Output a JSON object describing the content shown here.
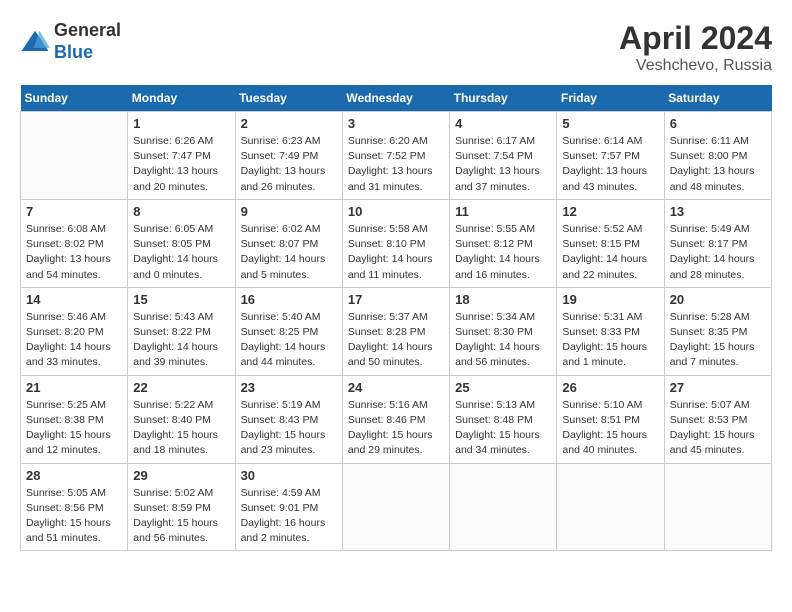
{
  "logo": {
    "general": "General",
    "blue": "Blue"
  },
  "title": "April 2024",
  "location": "Veshchevo, Russia",
  "days_header": [
    "Sunday",
    "Monday",
    "Tuesday",
    "Wednesday",
    "Thursday",
    "Friday",
    "Saturday"
  ],
  "weeks": [
    [
      {
        "day": "",
        "info": ""
      },
      {
        "day": "1",
        "info": "Sunrise: 6:26 AM\nSunset: 7:47 PM\nDaylight: 13 hours\nand 20 minutes."
      },
      {
        "day": "2",
        "info": "Sunrise: 6:23 AM\nSunset: 7:49 PM\nDaylight: 13 hours\nand 26 minutes."
      },
      {
        "day": "3",
        "info": "Sunrise: 6:20 AM\nSunset: 7:52 PM\nDaylight: 13 hours\nand 31 minutes."
      },
      {
        "day": "4",
        "info": "Sunrise: 6:17 AM\nSunset: 7:54 PM\nDaylight: 13 hours\nand 37 minutes."
      },
      {
        "day": "5",
        "info": "Sunrise: 6:14 AM\nSunset: 7:57 PM\nDaylight: 13 hours\nand 43 minutes."
      },
      {
        "day": "6",
        "info": "Sunrise: 6:11 AM\nSunset: 8:00 PM\nDaylight: 13 hours\nand 48 minutes."
      }
    ],
    [
      {
        "day": "7",
        "info": "Sunrise: 6:08 AM\nSunset: 8:02 PM\nDaylight: 13 hours\nand 54 minutes."
      },
      {
        "day": "8",
        "info": "Sunrise: 6:05 AM\nSunset: 8:05 PM\nDaylight: 14 hours\nand 0 minutes."
      },
      {
        "day": "9",
        "info": "Sunrise: 6:02 AM\nSunset: 8:07 PM\nDaylight: 14 hours\nand 5 minutes."
      },
      {
        "day": "10",
        "info": "Sunrise: 5:58 AM\nSunset: 8:10 PM\nDaylight: 14 hours\nand 11 minutes."
      },
      {
        "day": "11",
        "info": "Sunrise: 5:55 AM\nSunset: 8:12 PM\nDaylight: 14 hours\nand 16 minutes."
      },
      {
        "day": "12",
        "info": "Sunrise: 5:52 AM\nSunset: 8:15 PM\nDaylight: 14 hours\nand 22 minutes."
      },
      {
        "day": "13",
        "info": "Sunrise: 5:49 AM\nSunset: 8:17 PM\nDaylight: 14 hours\nand 28 minutes."
      }
    ],
    [
      {
        "day": "14",
        "info": "Sunrise: 5:46 AM\nSunset: 8:20 PM\nDaylight: 14 hours\nand 33 minutes."
      },
      {
        "day": "15",
        "info": "Sunrise: 5:43 AM\nSunset: 8:22 PM\nDaylight: 14 hours\nand 39 minutes."
      },
      {
        "day": "16",
        "info": "Sunrise: 5:40 AM\nSunset: 8:25 PM\nDaylight: 14 hours\nand 44 minutes."
      },
      {
        "day": "17",
        "info": "Sunrise: 5:37 AM\nSunset: 8:28 PM\nDaylight: 14 hours\nand 50 minutes."
      },
      {
        "day": "18",
        "info": "Sunrise: 5:34 AM\nSunset: 8:30 PM\nDaylight: 14 hours\nand 56 minutes."
      },
      {
        "day": "19",
        "info": "Sunrise: 5:31 AM\nSunset: 8:33 PM\nDaylight: 15 hours\nand 1 minute."
      },
      {
        "day": "20",
        "info": "Sunrise: 5:28 AM\nSunset: 8:35 PM\nDaylight: 15 hours\nand 7 minutes."
      }
    ],
    [
      {
        "day": "21",
        "info": "Sunrise: 5:25 AM\nSunset: 8:38 PM\nDaylight: 15 hours\nand 12 minutes."
      },
      {
        "day": "22",
        "info": "Sunrise: 5:22 AM\nSunset: 8:40 PM\nDaylight: 15 hours\nand 18 minutes."
      },
      {
        "day": "23",
        "info": "Sunrise: 5:19 AM\nSunset: 8:43 PM\nDaylight: 15 hours\nand 23 minutes."
      },
      {
        "day": "24",
        "info": "Sunrise: 5:16 AM\nSunset: 8:46 PM\nDaylight: 15 hours\nand 29 minutes."
      },
      {
        "day": "25",
        "info": "Sunrise: 5:13 AM\nSunset: 8:48 PM\nDaylight: 15 hours\nand 34 minutes."
      },
      {
        "day": "26",
        "info": "Sunrise: 5:10 AM\nSunset: 8:51 PM\nDaylight: 15 hours\nand 40 minutes."
      },
      {
        "day": "27",
        "info": "Sunrise: 5:07 AM\nSunset: 8:53 PM\nDaylight: 15 hours\nand 45 minutes."
      }
    ],
    [
      {
        "day": "28",
        "info": "Sunrise: 5:05 AM\nSunset: 8:56 PM\nDaylight: 15 hours\nand 51 minutes."
      },
      {
        "day": "29",
        "info": "Sunrise: 5:02 AM\nSunset: 8:59 PM\nDaylight: 15 hours\nand 56 minutes."
      },
      {
        "day": "30",
        "info": "Sunrise: 4:59 AM\nSunset: 9:01 PM\nDaylight: 16 hours\nand 2 minutes."
      },
      {
        "day": "",
        "info": ""
      },
      {
        "day": "",
        "info": ""
      },
      {
        "day": "",
        "info": ""
      },
      {
        "day": "",
        "info": ""
      }
    ]
  ]
}
